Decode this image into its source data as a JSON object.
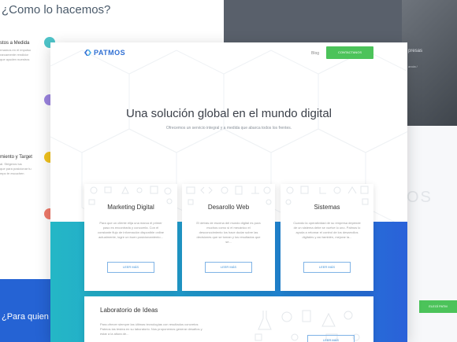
{
  "background": {
    "left": {
      "title": "¿Como lo hacemos?",
      "items": [
        {
          "title": "stos a Medida",
          "desc": "rmamos en el impulso\nrarcamente rendidor\nque ayuden nuestros",
          "color": "#4ec4c9",
          "icon": "layers-icon"
        },
        {
          "title": "",
          "desc": "",
          "color": "#9b84e0",
          "icon": "chat-icon"
        },
        {
          "title": "miento y Target",
          "desc": "al. Strigeros tus\nque para posicionar tu\nmpo te escuchen",
          "color": "#f3c31e",
          "icon": "target-icon"
        },
        {
          "title": "",
          "desc": "",
          "color": "#f07a6a",
          "icon": "chart-icon"
        }
      ],
      "wave_text": "¿Para quien l"
    },
    "right": {
      "text1": "presas",
      "text2": "ancia /",
      "logo_fragment": "OS",
      "button": "ELEGÍ PATM"
    }
  },
  "nav": {
    "logo": "PATMOS",
    "blog": "Blog",
    "contact": "CONTACTANOS"
  },
  "hero": {
    "title": "Una solución global en el mundo digital",
    "subtitle": "Ofrecemos un servicio integral y a medida que abarca todos los frentes."
  },
  "cards": [
    {
      "title": "Marketing Digital",
      "desc": "Para que un cliente elija una marca el primer paso es encontrarla y conocerla. Con el constante flujo de información disponible online actualmente, logre un buen posicionamiento...",
      "button": "LEER MÁS"
    },
    {
      "title": "Desarollo Web",
      "desc": "El detrás de escena del mundo digital es pura muchos como si el mecánico el desconocimiento los hace dudar sobre las decisiones que se toman y los resultados que se...",
      "button": "LEER MÁS"
    },
    {
      "title": "Sistemas",
      "desc": "Cuando la operatividad de su empresa depende de un sistema debe se vuelve lo uno. Palmos lo ayuda a retomar el control de los desarrollos digitales y así también, mejorar la...",
      "button": "LEER MÁS"
    }
  ],
  "lab": {
    "title": "Laboratorio de Ideas",
    "desc": "Para ofrecer siempre las últimas tecnologías con resultados concretos Patmos las testea en su laboratorio. Nos proponemos generar desafíos y estar a la altura de...",
    "button": "LEER MÁS"
  }
}
